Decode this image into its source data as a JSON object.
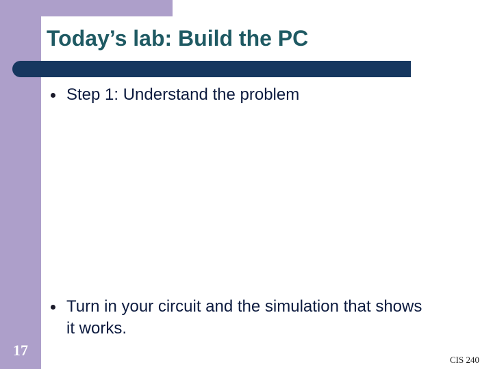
{
  "slide": {
    "title": "Today’s lab: Build the PC",
    "bullets": [
      "Step 1: Understand the problem",
      "Turn in your circuit and the simulation that shows it works."
    ],
    "slide_number": "17",
    "footer": "CIS 240"
  },
  "colors": {
    "side_band": "#ad9fca",
    "title_text": "#1f5a63",
    "title_bar": "#16375f",
    "body_text": "#0d1b3f"
  }
}
